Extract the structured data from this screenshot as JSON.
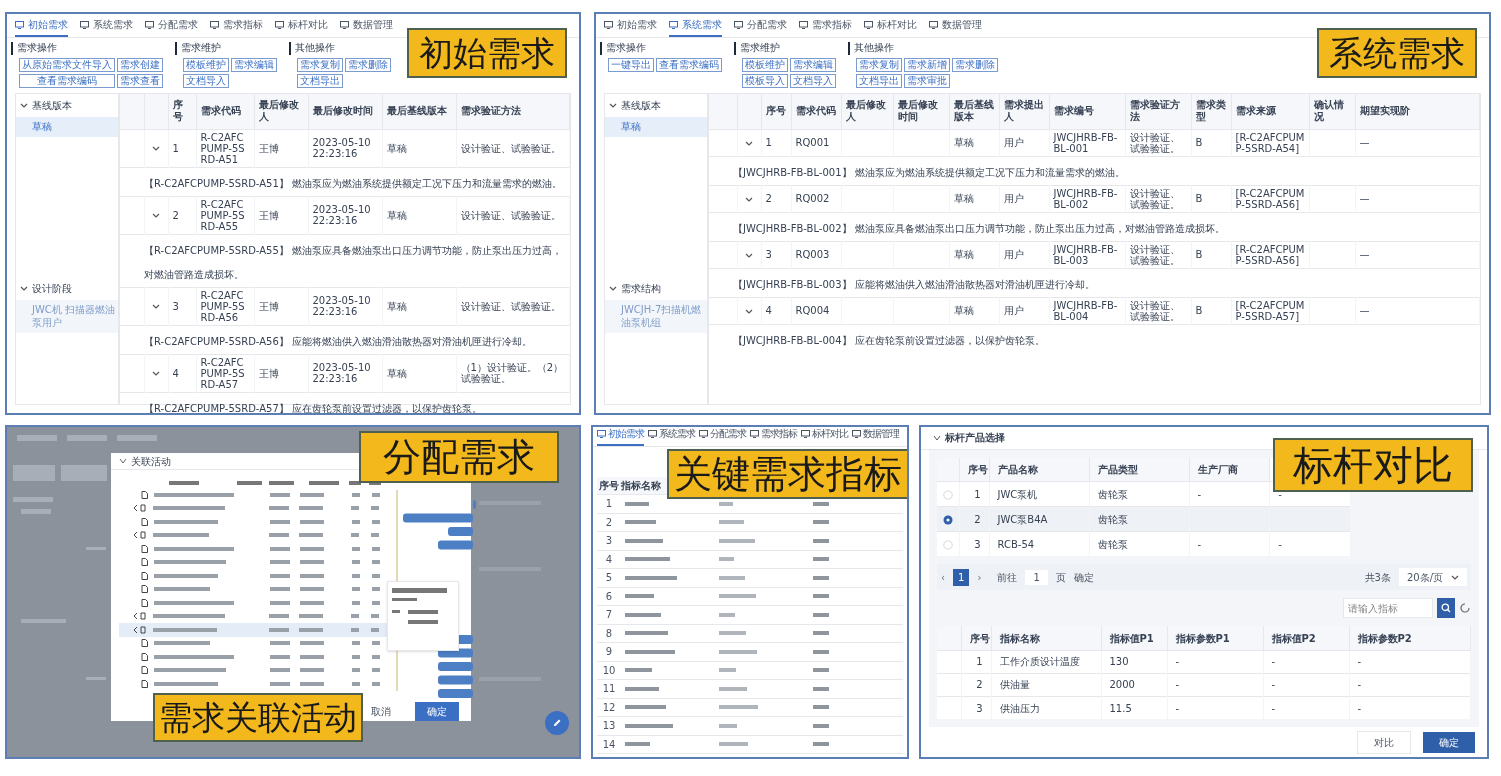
{
  "initial": {
    "caption": "初始需求",
    "tabs": [
      {
        "label": "初始需求",
        "selected": true
      },
      {
        "label": "系统需求",
        "selected": false
      },
      {
        "label": "分配需求",
        "selected": false
      },
      {
        "label": "需求指标",
        "selected": false
      },
      {
        "label": "标杆对比",
        "selected": false
      },
      {
        "label": "数据管理",
        "selected": false
      }
    ],
    "groups": [
      {
        "title": "需求操作",
        "buttons": [
          "从原始需求文件导入",
          "需求创建",
          "查看需求编码",
          "需求查看"
        ]
      },
      {
        "title": "需求维护",
        "buttons": [
          "模板维护",
          "需求编辑",
          "文档导入"
        ]
      },
      {
        "title": "其他操作",
        "buttons": [
          "需求复制",
          "需求删除",
          "文档导出"
        ]
      }
    ],
    "tree": [
      {
        "label": "基线版本",
        "expanded": true,
        "children": [
          {
            "label": "草稿",
            "selected": true
          }
        ]
      },
      {
        "label": "设计阶段",
        "expanded": true,
        "children": [
          {
            "label": "JWC机 扫描器燃油泵用户",
            "selected": false
          }
        ]
      }
    ],
    "columns": [
      "序号",
      "需求代码",
      "最后修改人",
      "最后修改时间",
      "最后基线版本",
      "需求验证方法"
    ],
    "rows": [
      {
        "cells": [
          "1",
          "R-C2AFCPUMP-5SRD-A51",
          "王博",
          "2023-05-10 22:23:16",
          "草稿",
          "设计验证、试验验证。"
        ],
        "description": "【R-C2AFCPUMP-5SRD-A51】 燃油泵应为燃油系统提供额定工况下压力和流量需求的燃油。"
      },
      {
        "cells": [
          "2",
          "R-C2AFCPUMP-5SRD-A55",
          "王博",
          "2023-05-10 22:23:16",
          "草稿",
          "设计验证、试验验证。"
        ],
        "description": "【R-C2AFCPUMP-5SRD-A55】 燃油泵应具备燃油泵出口压力调节功能，防止泵出压力过高，对燃油管路造成损坏。"
      },
      {
        "cells": [
          "3",
          "R-C2AFCPUMP-5SRD-A56",
          "王博",
          "2023-05-10 22:23:16",
          "草稿",
          "设计验证、试验验证。"
        ],
        "description": "【R-C2AFCPUMP-5SRD-A56】 应能将燃油供入燃油滑油散热器对滑油机匣进行冷却。"
      },
      {
        "cells": [
          "4",
          "R-C2AFCPUMP-5SRD-A57",
          "王博",
          "2023-05-10 22:23:16",
          "草稿",
          "（1）设计验证。（2）试验验证。"
        ],
        "description": "【R-C2AFCPUMP-5SRD-A57】 应在齿轮泵前设置过滤器，以保护齿轮泵。"
      }
    ]
  },
  "system": {
    "caption": "系统需求",
    "tabs": [
      {
        "label": "初始需求",
        "selected": false
      },
      {
        "label": "系统需求",
        "selected": true
      },
      {
        "label": "分配需求",
        "selected": false
      },
      {
        "label": "需求指标",
        "selected": false
      },
      {
        "label": "标杆对比",
        "selected": false
      },
      {
        "label": "数据管理",
        "selected": false
      }
    ],
    "groups": [
      {
        "title": "需求操作",
        "buttons": [
          "一键导出",
          "查看需求编码"
        ]
      },
      {
        "title": "需求维护",
        "buttons": [
          "模板维护",
          "需求编辑",
          "模板导入",
          "文档导入"
        ]
      },
      {
        "title": "其他操作",
        "buttons": [
          "需求复制",
          "需求新增",
          "需求删除",
          "文档导出",
          "需求审批"
        ]
      }
    ],
    "tree": [
      {
        "label": "基线版本",
        "expanded": true,
        "children": [
          {
            "label": "草稿",
            "selected": true
          }
        ]
      },
      {
        "label": "需求结构",
        "expanded": true,
        "children": [
          {
            "label": "JWCJH-7扫描机燃油泵机组",
            "selected": false
          }
        ]
      }
    ],
    "columns": [
      "序号",
      "需求代码",
      "最后修改人",
      "最后修改时间",
      "最后基线版本",
      "需求提出人",
      "需求编号",
      "需求验证方法",
      "需求类型",
      "需求来源",
      "确认情况",
      "期望实现阶"
    ],
    "rows": [
      {
        "cells": [
          "1",
          "RQ001",
          null,
          null,
          "草稿",
          "用户",
          "JWCJHRB-FB-BL-001",
          "设计验证、试验验证。",
          "B",
          "[R-C2AFCPUMP-5SRD-A54]",
          null,
          "—"
        ],
        "description": "【JWCJHRB-FB-BL-001】 燃油泵应为燃油系统提供额定工况下压力和流量需求的燃油。"
      },
      {
        "cells": [
          "2",
          "RQ002",
          null,
          null,
          "草稿",
          "用户",
          "JWCJHRB-FB-BL-002",
          "设计验证、试验验证。",
          "B",
          "[R-C2AFCPUMP-5SRD-A56]",
          null,
          "—"
        ],
        "description": "【JWCJHRB-FB-BL-002】 燃油泵应具备燃油泵出口压力调节功能，防止泵出压力过高，对燃油管路造成损坏。"
      },
      {
        "cells": [
          "3",
          "RQ003",
          null,
          null,
          "草稿",
          "用户",
          "JWCJHRB-FB-BL-003",
          "设计验证、试验验证。",
          "B",
          "[R-C2AFCPUMP-5SRD-A56]",
          null,
          "—"
        ],
        "description": "【JWCJHRB-FB-BL-003】 应能将燃油供入燃油滑油散热器对滑油机匣进行冷却。"
      },
      {
        "cells": [
          "4",
          "RQ004",
          null,
          null,
          "草稿",
          "用户",
          "JWCJHRB-FB-BL-004",
          "设计验证、试验验证。",
          "B",
          "[R-C2AFCPUMP-5SRD-A57]",
          null,
          "—"
        ],
        "description": "【JWCJHRB-FB-BL-004】 应在齿轮泵前设置过滤器，以保护齿轮泵。"
      }
    ]
  },
  "allocation": {
    "captions": [
      "分配需求",
      "需求关联活动"
    ],
    "dialog": {
      "title": "关联活动",
      "buttons": [
        {
          "label": "取消",
          "kind": "secondary"
        },
        {
          "label": "确定",
          "kind": "primary"
        }
      ],
      "rows": [
        {
          "kind": "file",
          "selected": false
        },
        {
          "kind": "folder",
          "selected": false
        },
        {
          "kind": "file",
          "selected": false
        },
        {
          "kind": "folder",
          "selected": false
        },
        {
          "kind": "file",
          "selected": false
        },
        {
          "kind": "file",
          "selected": false
        },
        {
          "kind": "file",
          "selected": false
        },
        {
          "kind": "file",
          "selected": false
        },
        {
          "kind": "file",
          "selected": false
        },
        {
          "kind": "folder",
          "selected": false
        },
        {
          "kind": "folder",
          "selected": true
        },
        {
          "kind": "file",
          "selected": false
        },
        {
          "kind": "file",
          "selected": false
        },
        {
          "kind": "file",
          "selected": false
        },
        {
          "kind": "file",
          "selected": false
        }
      ]
    }
  },
  "indicators": {
    "caption": "关键需求指标",
    "tabs": [
      {
        "label": "初始需求",
        "selected": true
      },
      {
        "label": "系统需求",
        "selected": false
      },
      {
        "label": "分配需求",
        "selected": false
      },
      {
        "label": "需求指标",
        "selected": false
      },
      {
        "label": "标杆对比",
        "selected": false
      },
      {
        "label": "数据管理",
        "selected": false
      }
    ],
    "columns": [
      "序号",
      "指标名称"
    ],
    "rows": [
      "1",
      "2",
      "3",
      "4",
      "5",
      "6",
      "7",
      "8",
      "9",
      "10",
      "11",
      "12",
      "13",
      "14"
    ]
  },
  "benchmark": {
    "title": "标杆产品选择",
    "caption": "标杆对比",
    "product_columns": [
      "序号",
      "产品名称",
      "产品类型",
      "生产厂商"
    ],
    "products": [
      {
        "selected": false,
        "cells": [
          "1",
          "JWC泵机",
          "齿轮泵",
          "-",
          "-"
        ]
      },
      {
        "selected": true,
        "cells": [
          "2",
          "JWC泵B4A",
          "齿轮泵",
          null,
          null
        ]
      },
      {
        "selected": false,
        "cells": [
          "3",
          "RCB-54",
          "齿轮泵",
          "-",
          "-"
        ]
      }
    ],
    "pagination": {
      "prev": "‹",
      "page": "1",
      "next": "›",
      "goto": "前往",
      "page_input": "1",
      "page_unit": "页",
      "confirm": "确定",
      "total": "共3条",
      "page_size": "20条/页"
    },
    "search": {
      "placeholder": "请输入指标"
    },
    "indicator_columns": [
      "序号",
      "指标名称",
      "指标值P1",
      "指标参数P1",
      "指标值P2",
      "指标参数P2"
    ],
    "indicators": [
      [
        "1",
        "工作介质设计温度",
        "130",
        "-",
        "-",
        "-"
      ],
      [
        "2",
        "供油量",
        "2000",
        "-",
        "-",
        "-"
      ],
      [
        "3",
        "供油压力",
        "11.5",
        "-",
        "-",
        "-"
      ]
    ],
    "buttons": [
      {
        "label": "对比",
        "kind": "secondary"
      },
      {
        "label": "确定",
        "kind": "primary"
      }
    ]
  }
}
